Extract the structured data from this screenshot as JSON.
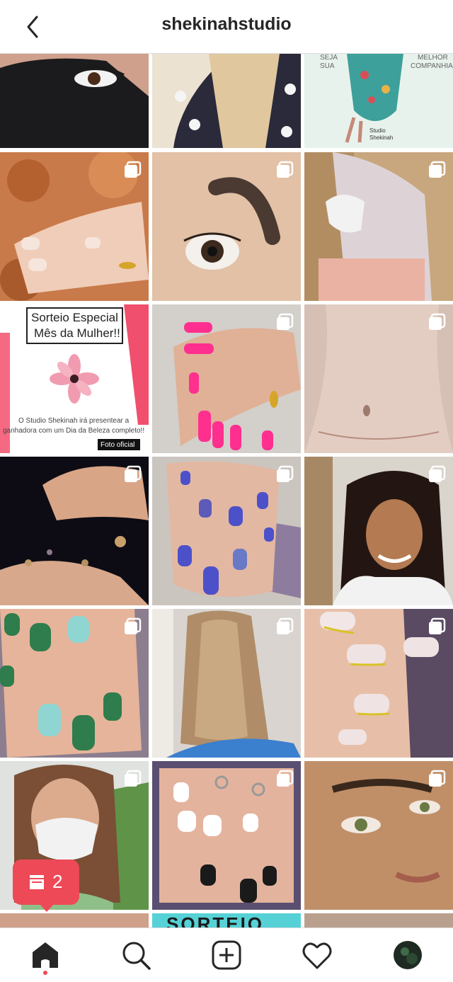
{
  "header": {
    "title": "shekinahstudio",
    "back_icon": "chevron-left-icon"
  },
  "colors": {
    "accent": "#ed4956",
    "text": "#262626",
    "divider": "#dbdbdb"
  },
  "grid": {
    "posts": [
      {
        "name": "post-1",
        "subject": "eye-with-face-mask",
        "multi": false
      },
      {
        "name": "post-2",
        "subject": "blonde-hair-polka-dot",
        "multi": false
      },
      {
        "name": "post-3",
        "subject": "illustration-studio-shekinah",
        "multi": false,
        "texts": [
          "SEJA",
          "SUA",
          "MELHOR",
          "COMPANHIA",
          "Studio",
          "Shekinah"
        ]
      },
      {
        "name": "post-4",
        "subject": "nude-nails-autumn-leaves",
        "multi": true
      },
      {
        "name": "post-5",
        "subject": "eyebrow-microblading",
        "multi": true
      },
      {
        "name": "post-6",
        "subject": "silver-hair-woman",
        "multi": true
      },
      {
        "name": "post-7",
        "subject": "sorteio-especial-flyer",
        "multi": false,
        "texts": [
          "Sorteio Especial",
          "Mês da Mulher!!",
          "O Studio Shekinah irá presentear a",
          "ganhadora com um Dia da Beleza completo!!",
          "Foto oficial"
        ]
      },
      {
        "name": "post-8",
        "subject": "pink-nails",
        "multi": true
      },
      {
        "name": "post-9",
        "subject": "abdomen",
        "multi": true
      },
      {
        "name": "post-10",
        "subject": "hands-with-planets",
        "multi": true
      },
      {
        "name": "post-11",
        "subject": "blue-glitter-nails",
        "multi": true
      },
      {
        "name": "post-12",
        "subject": "smiling-woman",
        "multi": true
      },
      {
        "name": "post-13",
        "subject": "green-nails-leaf-art",
        "multi": true
      },
      {
        "name": "post-14",
        "subject": "balayage-hair",
        "multi": true
      },
      {
        "name": "post-15",
        "subject": "gold-glitter-french-nails",
        "multi": true
      },
      {
        "name": "post-16",
        "subject": "woman-with-mask",
        "multi": true
      },
      {
        "name": "post-17",
        "subject": "black-white-nails",
        "multi": true
      },
      {
        "name": "post-18",
        "subject": "eyelashes-closeup",
        "multi": true
      },
      {
        "name": "post-19",
        "subject": "partial-row",
        "multi": true
      },
      {
        "name": "post-20",
        "subject": "sorteio-partial",
        "multi": false,
        "texts": [
          "SORTEIO"
        ]
      },
      {
        "name": "post-21",
        "subject": "partial-row",
        "multi": false
      }
    ]
  },
  "notification": {
    "count": "2",
    "icon": "feed-post-icon"
  },
  "tabbar": {
    "items": [
      {
        "name": "home",
        "icon": "home-icon"
      },
      {
        "name": "search",
        "icon": "search-icon"
      },
      {
        "name": "new-post",
        "icon": "add-post-icon"
      },
      {
        "name": "activity",
        "icon": "heart-icon"
      },
      {
        "name": "profile",
        "icon": "avatar-icon"
      }
    ]
  }
}
